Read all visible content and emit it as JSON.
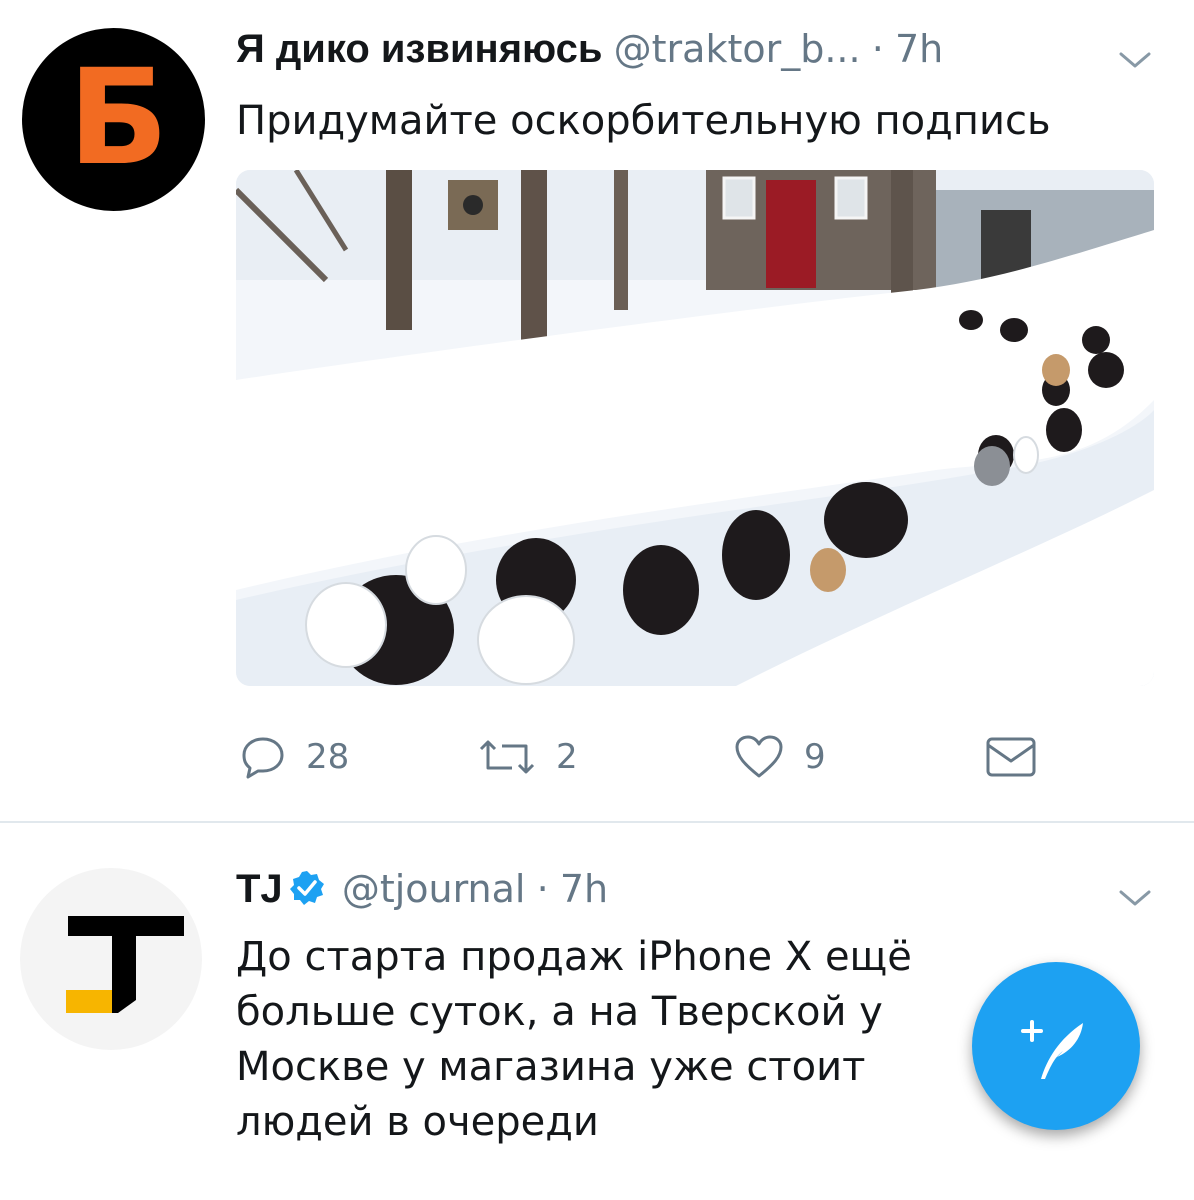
{
  "tweets": [
    {
      "avatar_letter": "Б",
      "display_name": "Я дико извиняюсь",
      "handle": "@traktor_b...",
      "separator": "·",
      "time": "7h",
      "text": "Придумайте оскорбительную подпись",
      "media_description_icon": "photo",
      "actions": {
        "reply_count": "28",
        "retweet_count": "2",
        "like_count": "9"
      }
    },
    {
      "display_name": "TJ",
      "verified": true,
      "handle": "@tjournal",
      "separator": "·",
      "time": "7h",
      "text_lines": [
        "До старта продаж iPhone X ещё",
        "больше суток, а на Тверской у",
        "Москве у магазина уже стоит",
        "людей в очереди"
      ]
    }
  ],
  "compose_button_icon": "plus-feather-icon",
  "colors": {
    "accent": "#1da1f2",
    "secondary_text": "#657786",
    "avatar1_bg": "#000000",
    "avatar1_letter": "#f26b22",
    "tj_yellow": "#f7b500"
  }
}
